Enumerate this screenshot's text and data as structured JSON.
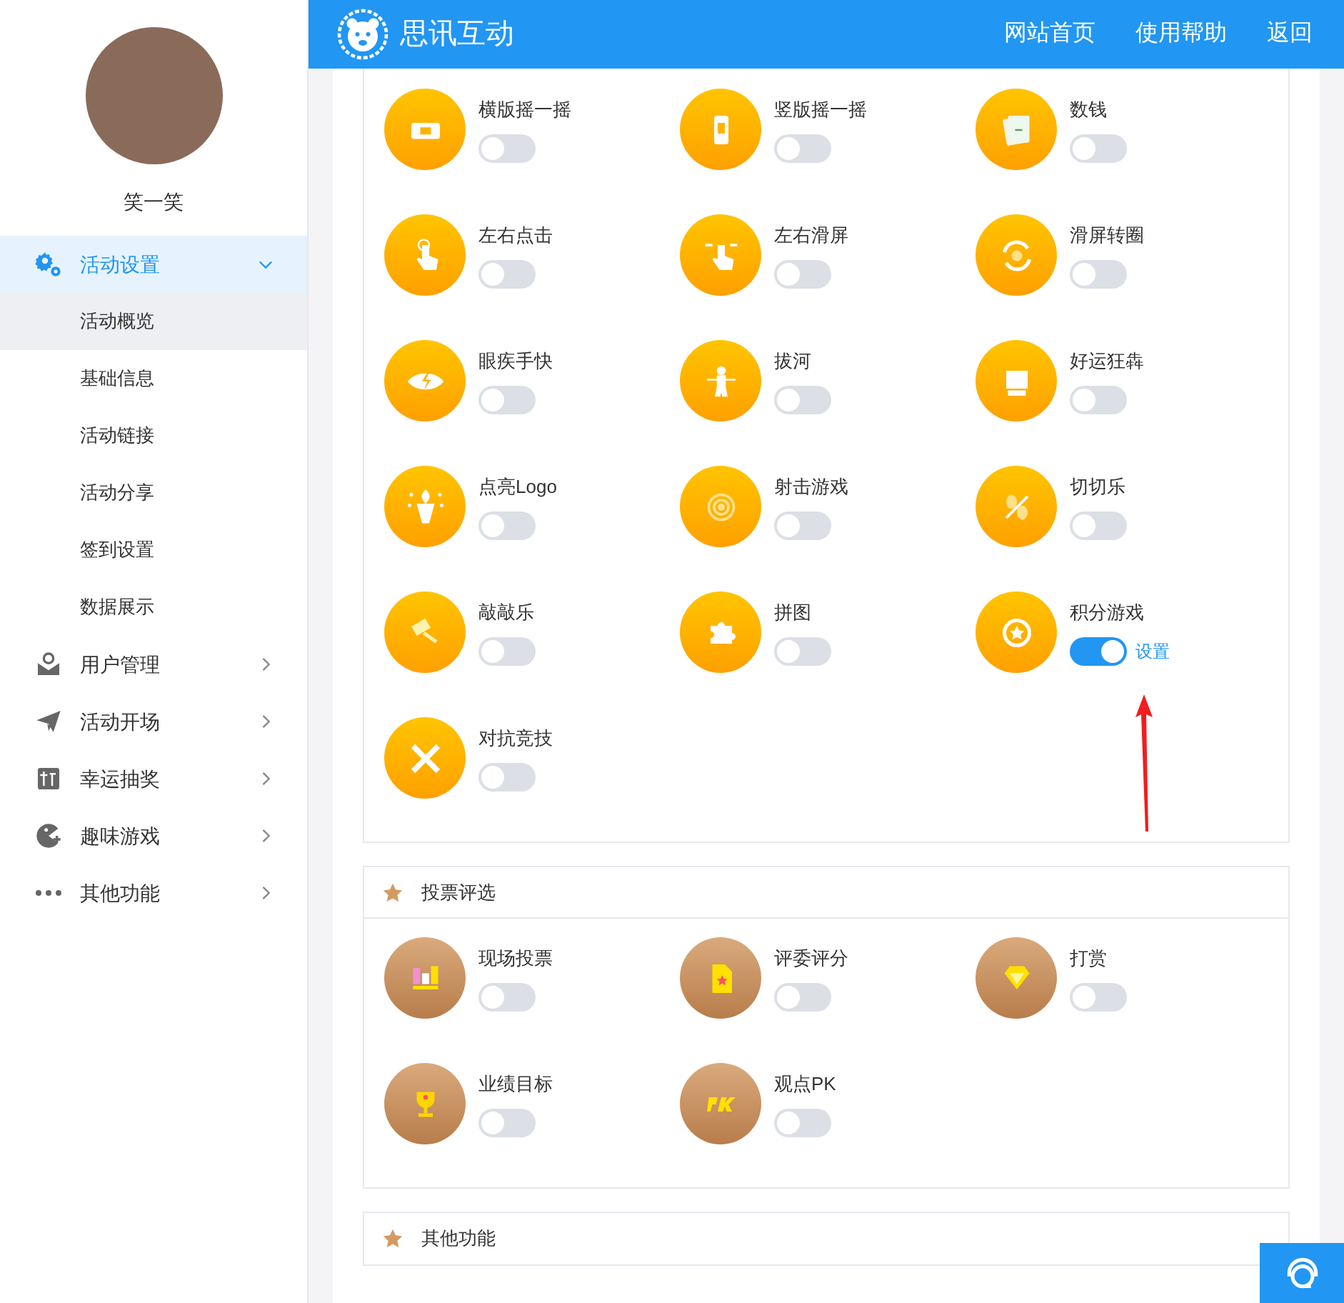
{
  "header": {
    "logo_text": "思讯互动",
    "nav": [
      {
        "label": "网站首页"
      },
      {
        "label": "使用帮助"
      },
      {
        "label": "返回"
      }
    ]
  },
  "sidebar": {
    "user_name": "笑一笑",
    "menu": [
      {
        "label": "活动设置",
        "selected": true,
        "expanded": true,
        "children": [
          {
            "label": "活动概览",
            "selected": true
          },
          {
            "label": "基础信息",
            "selected": false
          },
          {
            "label": "活动链接",
            "selected": false
          },
          {
            "label": "活动分享",
            "selected": false
          },
          {
            "label": "签到设置",
            "selected": false
          },
          {
            "label": "数据展示",
            "selected": false
          }
        ]
      },
      {
        "label": "用户管理",
        "selected": false,
        "expanded": false
      },
      {
        "label": "活动开场",
        "selected": false,
        "expanded": false
      },
      {
        "label": "幸运抽奖",
        "selected": false,
        "expanded": false
      },
      {
        "label": "趣味游戏",
        "selected": false,
        "expanded": false
      },
      {
        "label": "其他功能",
        "selected": false,
        "expanded": false
      }
    ]
  },
  "sections": [
    {
      "kind": "game",
      "items": [
        {
          "label": "横版摇一摇",
          "on": false
        },
        {
          "label": "竖版摇一摇",
          "on": false
        },
        {
          "label": "数钱",
          "on": false
        },
        {
          "label": "左右点击",
          "on": false
        },
        {
          "label": "左右滑屏",
          "on": false
        },
        {
          "label": "滑屏转圈",
          "on": false
        },
        {
          "label": "眼疾手快",
          "on": false
        },
        {
          "label": "拔河",
          "on": false
        },
        {
          "label": "好运狂犇",
          "on": false
        },
        {
          "label": "点亮Logo",
          "on": false
        },
        {
          "label": "射击游戏",
          "on": false
        },
        {
          "label": "切切乐",
          "on": false
        },
        {
          "label": "敲敲乐",
          "on": false
        },
        {
          "label": "拼图",
          "on": false
        },
        {
          "label": "积分游戏",
          "on": true,
          "settings_link": "设置"
        },
        {
          "label": "对抗竞技",
          "on": false
        }
      ]
    },
    {
      "kind": "vote",
      "title": "投票评选",
      "items": [
        {
          "label": "现场投票",
          "on": false
        },
        {
          "label": "评委评分",
          "on": false
        },
        {
          "label": "打赏",
          "on": false
        },
        {
          "label": "业绩目标",
          "on": false
        },
        {
          "label": "观点PK",
          "on": false
        }
      ]
    },
    {
      "kind": "other",
      "title": "其他功能"
    }
  ]
}
